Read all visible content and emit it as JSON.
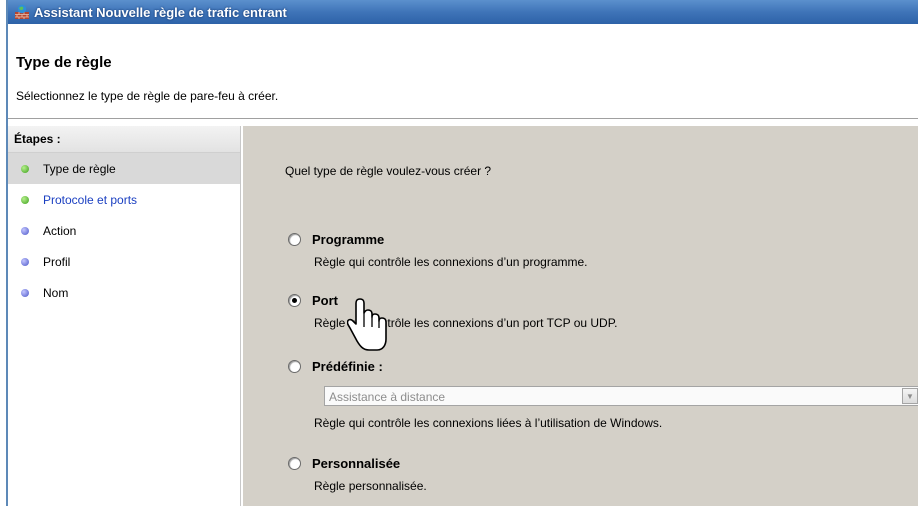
{
  "window": {
    "title": "Assistant Nouvelle règle de trafic entrant"
  },
  "header": {
    "title": "Type de règle",
    "subtitle": "Sélectionnez le type de règle de pare-feu à créer."
  },
  "sidebar": {
    "title": "Étapes :",
    "steps": [
      {
        "label": "Type de règle",
        "status": "current",
        "dot": "green"
      },
      {
        "label": "Protocole et ports",
        "status": "link",
        "dot": "green"
      },
      {
        "label": "Action",
        "status": "pending",
        "dot": "blue"
      },
      {
        "label": "Profil",
        "status": "pending",
        "dot": "blue"
      },
      {
        "label": "Nom",
        "status": "pending",
        "dot": "blue"
      }
    ]
  },
  "main": {
    "question": "Quel type de règle voulez-vous créer ?",
    "options": [
      {
        "label": "Programme",
        "desc": "Règle qui contrôle les connexions d’un programme.",
        "checked": false
      },
      {
        "label": "Port",
        "desc": "Règle qui contrôle les connexions d’un port TCP ou UDP.",
        "checked": true
      },
      {
        "label": "Prédéfinie :",
        "desc": "Règle qui contrôle les connexions liées à l’utilisation de Windows.",
        "checked": false
      },
      {
        "label": "Personnalisée",
        "desc": "Règle personnalisée.",
        "checked": false
      }
    ],
    "predefined_select": {
      "value": "Assistance à distance",
      "disabled": true
    }
  },
  "colors": {
    "titlebar": "#3f74b8",
    "panel_bg": "#d4d0c8",
    "link": "#1a3fc1",
    "dot_green": "#3c9f1c",
    "dot_blue": "#4a56c8"
  },
  "icons": {
    "app": "firewall-icon",
    "cursor": "hand-pointer-icon"
  }
}
